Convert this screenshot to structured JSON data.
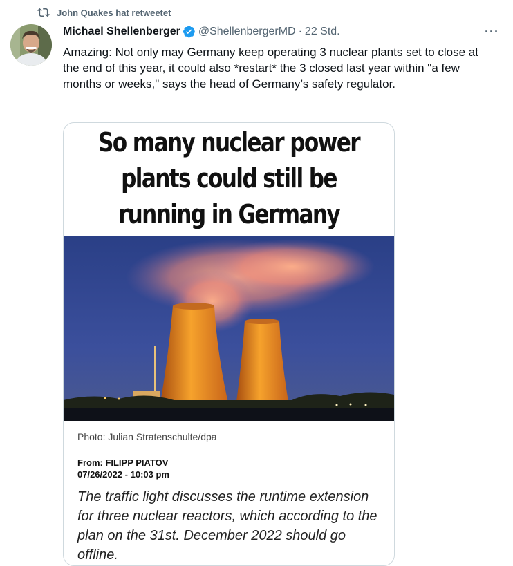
{
  "retweet": {
    "label": "John Quakes hat retweetet",
    "icon": "retweet-icon"
  },
  "tweet": {
    "author_name": "Michael Shellenberger",
    "verified": true,
    "handle": "@ShellenbergerMD",
    "separator": "·",
    "time": "22 Std.",
    "more": "···",
    "text": "Amazing: Not only may Germany keep operating 3 nuclear plants set to close at the end of this year, it could also *restart* the 3 closed last year within \"a few months or weeks,\" says the head of Germany’s safety regulator."
  },
  "card": {
    "headline_lines": [
      "So many nuclear power",
      "plants could still be",
      "running in Germany"
    ],
    "photo_caption": "Photo: Julian Stratenschulte/dpa",
    "byline_author": "From: FILIPP PIATOV",
    "byline_date": "07/26/2022 - 10:03 pm",
    "lead": "The traffic light discusses the runtime extension for three nuclear reactors, which according to the plan on the 31st. December 2022 should go offline."
  },
  "colors": {
    "accent": "#1d9bf0",
    "muted": "#536471",
    "text": "#0f1419"
  }
}
